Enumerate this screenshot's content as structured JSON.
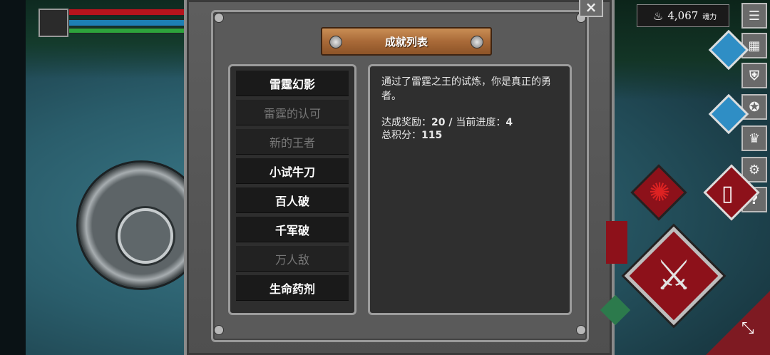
{
  "panel": {
    "title": "成就列表",
    "close_icon": "×"
  },
  "achievements": {
    "items": [
      {
        "label": "雷霆幻影",
        "state": "unlocked"
      },
      {
        "label": "雷霆的认可",
        "state": "locked"
      },
      {
        "label": "新的王者",
        "state": "locked"
      },
      {
        "label": "小试牛刀",
        "state": "unlocked"
      },
      {
        "label": "百人破",
        "state": "unlocked"
      },
      {
        "label": "千军破",
        "state": "unlocked"
      },
      {
        "label": "万人敌",
        "state": "locked"
      },
      {
        "label": "生命药剂",
        "state": "unlocked"
      }
    ]
  },
  "detail": {
    "description": "通过了雷霆之王的试炼，你是真正的勇者。",
    "reward_label": "达成奖励：",
    "reward_value": "20",
    "separator": " / ",
    "progress_label": "当前进度：",
    "progress_value": "4",
    "total_label": "总积分：",
    "total_value": "115"
  },
  "currency": {
    "icon": "flame-icon",
    "amount": "4,067",
    "label": "魂力"
  },
  "toolbar": {
    "menu_icon": "☰",
    "help_icon": "?",
    "settings_icon": "⚙",
    "crown_icon": "♛"
  },
  "player": {
    "hp": 1.0,
    "mp": 1.0,
    "stamina": 1.0
  },
  "colors": {
    "hp": "#b6141c",
    "mp": "#1d7fb3",
    "stamina": "#2da33c",
    "plank": "#a96a38",
    "skill_red": "#8d111a"
  }
}
